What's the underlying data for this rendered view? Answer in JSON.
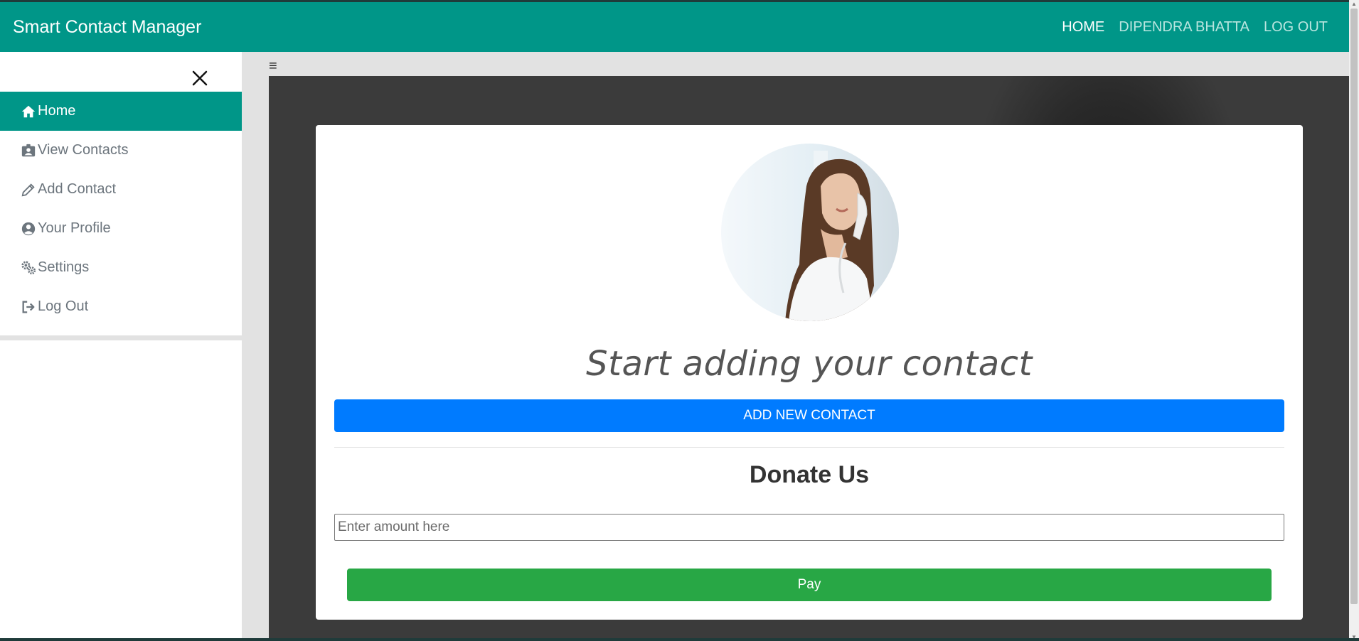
{
  "app": {
    "brand": "Smart Contact Manager"
  },
  "nav": {
    "links": [
      {
        "label": "HOME",
        "active": true
      },
      {
        "label": "DIPENDRA BHATTA",
        "active": false
      },
      {
        "label": "LOG OUT",
        "active": false
      }
    ]
  },
  "sidebar": {
    "close_icon": "close-icon",
    "items": [
      {
        "label": "Home",
        "icon": "home-icon",
        "active": true
      },
      {
        "label": "View Contacts",
        "icon": "contact-card-icon",
        "active": false
      },
      {
        "label": "Add Contact",
        "icon": "pencil-icon",
        "active": false
      },
      {
        "label": "Your Profile",
        "icon": "user-circle-icon",
        "active": false
      },
      {
        "label": "Settings",
        "icon": "gears-icon",
        "active": false
      },
      {
        "label": "Log Out",
        "icon": "sign-out-icon",
        "active": false
      }
    ]
  },
  "main": {
    "menu_icon": "hamburger-icon",
    "hamburger_glyph": "≡",
    "title": "Start adding your contact",
    "add_button": "ADD NEW CONTACT",
    "donate_title": "Donate Us",
    "amount_placeholder": "Enter amount here",
    "pay_button": "Pay"
  },
  "colors": {
    "primary": "#009688",
    "blue": "#007bff",
    "green": "#28a745"
  }
}
